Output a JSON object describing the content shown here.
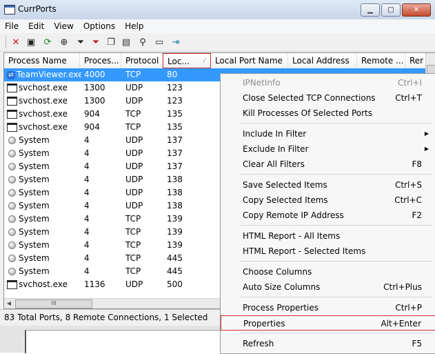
{
  "window": {
    "title": "CurrPorts"
  },
  "menubar": [
    "File",
    "Edit",
    "View",
    "Options",
    "Help"
  ],
  "columns": [
    {
      "label": "Process Name",
      "w": 110
    },
    {
      "label": "Proces...",
      "w": 60
    },
    {
      "label": "Protocol",
      "w": 60
    },
    {
      "label": "Loc...",
      "w": 70,
      "sorted": true
    },
    {
      "label": "Local Port Name",
      "w": 112
    },
    {
      "label": "Local Address",
      "w": 100
    },
    {
      "label": "Remote ...",
      "w": 70
    },
    {
      "label": "Rer",
      "w": 40
    }
  ],
  "rows": [
    {
      "icon": "teamviewer-icon",
      "name": "TeamViewer.exe",
      "pid": "4000",
      "proto": "TCP",
      "port": "80",
      "selected": true
    },
    {
      "icon": "window-icon",
      "name": "svchost.exe",
      "pid": "1300",
      "proto": "UDP",
      "port": "123"
    },
    {
      "icon": "window-icon",
      "name": "svchost.exe",
      "pid": "1300",
      "proto": "UDP",
      "port": "123"
    },
    {
      "icon": "window-icon",
      "name": "svchost.exe",
      "pid": "904",
      "proto": "TCP",
      "port": "135"
    },
    {
      "icon": "window-icon",
      "name": "svchost.exe",
      "pid": "904",
      "proto": "TCP",
      "port": "135"
    },
    {
      "icon": "system-icon",
      "name": "System",
      "pid": "4",
      "proto": "UDP",
      "port": "137"
    },
    {
      "icon": "system-icon",
      "name": "System",
      "pid": "4",
      "proto": "UDP",
      "port": "137"
    },
    {
      "icon": "system-icon",
      "name": "System",
      "pid": "4",
      "proto": "UDP",
      "port": "137"
    },
    {
      "icon": "system-icon",
      "name": "System",
      "pid": "4",
      "proto": "UDP",
      "port": "138"
    },
    {
      "icon": "system-icon",
      "name": "System",
      "pid": "4",
      "proto": "UDP",
      "port": "138"
    },
    {
      "icon": "system-icon",
      "name": "System",
      "pid": "4",
      "proto": "UDP",
      "port": "138"
    },
    {
      "icon": "system-icon",
      "name": "System",
      "pid": "4",
      "proto": "TCP",
      "port": "139"
    },
    {
      "icon": "system-icon",
      "name": "System",
      "pid": "4",
      "proto": "TCP",
      "port": "139"
    },
    {
      "icon": "system-icon",
      "name": "System",
      "pid": "4",
      "proto": "TCP",
      "port": "139"
    },
    {
      "icon": "system-icon",
      "name": "System",
      "pid": "4",
      "proto": "TCP",
      "port": "445"
    },
    {
      "icon": "system-icon",
      "name": "System",
      "pid": "4",
      "proto": "TCP",
      "port": "445"
    },
    {
      "icon": "window-icon",
      "name": "svchost.exe",
      "pid": "1136",
      "proto": "UDP",
      "port": "500"
    }
  ],
  "status": {
    "text": "83 Total Ports, 8 Remote Connections, 1 Selected"
  },
  "context_menu": [
    {
      "label": "IPNetInfo",
      "shortcut": "Ctrl+I",
      "disabled": true
    },
    {
      "label": "Close Selected TCP Connections",
      "shortcut": "Ctrl+T"
    },
    {
      "label": "Kill Processes Of Selected Ports",
      "shortcut": ""
    },
    {
      "sep": true
    },
    {
      "label": "Include In Filter",
      "submenu": true
    },
    {
      "label": "Exclude In Filter",
      "submenu": true
    },
    {
      "label": "Clear All Filters",
      "shortcut": "F8"
    },
    {
      "sep": true
    },
    {
      "label": "Save Selected Items",
      "shortcut": "Ctrl+S"
    },
    {
      "label": "Copy Selected Items",
      "shortcut": "Ctrl+C"
    },
    {
      "label": "Copy Remote IP Address",
      "shortcut": "F2"
    },
    {
      "sep": true
    },
    {
      "label": "HTML Report - All Items",
      "shortcut": ""
    },
    {
      "label": "HTML Report - Selected Items",
      "shortcut": ""
    },
    {
      "sep": true
    },
    {
      "label": "Choose Columns",
      "shortcut": ""
    },
    {
      "label": "Auto Size Columns",
      "shortcut": "Ctrl+Plus"
    },
    {
      "sep": true
    },
    {
      "label": "Process Properties",
      "shortcut": "Ctrl+P"
    },
    {
      "label": "Properties",
      "shortcut": "Alt+Enter",
      "highlighted": true
    },
    {
      "sep": true
    },
    {
      "label": "Refresh",
      "shortcut": "F5"
    }
  ],
  "toolbar": [
    {
      "icon": "delete-icon",
      "glyph": "✕",
      "color": "#d01010"
    },
    {
      "icon": "save-icon",
      "glyph": "▣",
      "color": "#222222"
    },
    {
      "icon": "refresh-icon",
      "glyph": "⟳",
      "color": "#208020"
    },
    {
      "icon": "target-icon",
      "glyph": "⊕",
      "color": "#222222"
    },
    {
      "icon": "filter-icon",
      "glyph": "⏷",
      "color": "#222222"
    },
    {
      "icon": "filter-clear-icon",
      "glyph": "⏷",
      "color": "#c02020"
    },
    {
      "icon": "copy-icon",
      "glyph": "❐",
      "color": "#333333"
    },
    {
      "icon": "html-report-icon",
      "glyph": "▤",
      "color": "#333333"
    },
    {
      "icon": "find-icon",
      "glyph": "⚲",
      "color": "#222222"
    },
    {
      "icon": "properties-icon",
      "glyph": "▭",
      "color": "#333333"
    },
    {
      "icon": "exit-icon",
      "glyph": "⇥",
      "color": "#1a7fa8"
    }
  ]
}
